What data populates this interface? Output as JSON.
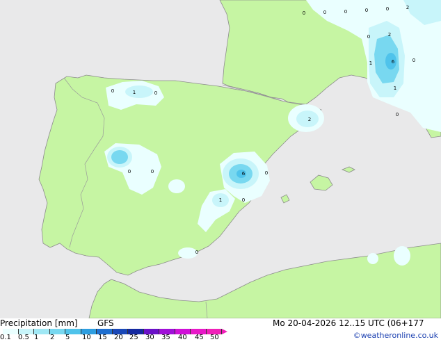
{
  "title": {
    "product": "Precipitation [mm]",
    "model": "GFS"
  },
  "valid_time": "Mo 20-04-2026 12..15 UTC (06+177",
  "credit": "©weatheronline.co.uk",
  "legend": {
    "ticks": [
      "0.1",
      "0.5",
      "1",
      "2",
      "5",
      "10",
      "15",
      "20",
      "25",
      "30",
      "35",
      "40",
      "45",
      "50"
    ],
    "colors": [
      "#eaffff",
      "#c8f5fa",
      "#a0e8f5",
      "#78d8f0",
      "#4fc3eb",
      "#2e9ee0",
      "#1f6fd0",
      "#1a48b8",
      "#1429a0",
      "#6a10c8",
      "#a010d8",
      "#d010d8",
      "#e818c8",
      "#f020b8"
    ]
  },
  "colors": {
    "sea": "#e9e9ea",
    "land": "#c6f5a3",
    "coast": "#8c8c8c",
    "border": "#9a9a9a"
  },
  "map_labels": [
    "0",
    "0",
    "0",
    "0",
    "0",
    "2",
    "2",
    "0",
    "1",
    "6",
    "0",
    "1",
    "0",
    "0",
    "0",
    "1",
    "0",
    "2",
    "0",
    "0",
    "6",
    "0",
    "1",
    "0",
    "0"
  ]
}
